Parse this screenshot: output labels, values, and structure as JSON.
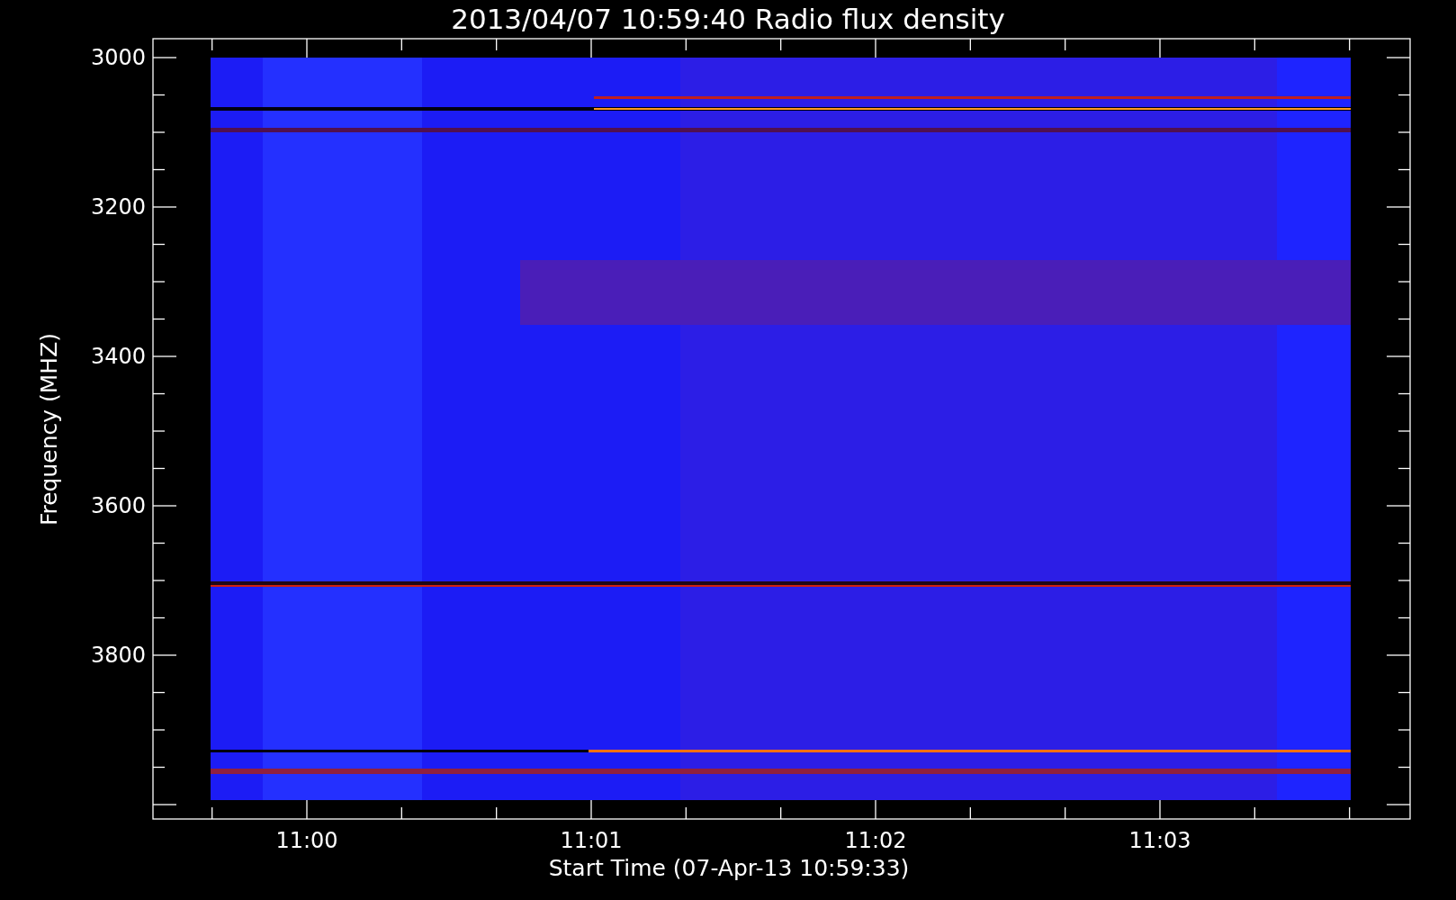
{
  "title": "2013/04/07 10:59:40 Radio flux density",
  "y_axis": {
    "label": "Frequency (MHZ)",
    "ticks": [
      "3000",
      "3200",
      "3400",
      "3600",
      "3800"
    ]
  },
  "x_axis": {
    "label": "Start Time (07-Apr-13 10:59:33)",
    "ticks": [
      "11:00",
      "11:01",
      "11:02",
      "11:03"
    ]
  }
}
